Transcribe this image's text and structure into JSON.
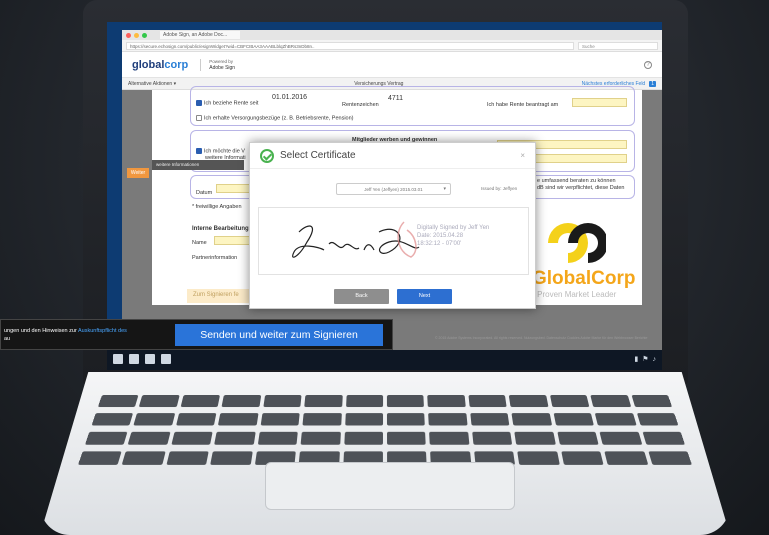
{
  "browser": {
    "tab_title": "Adobe Sign, an Adobe Doc...",
    "url": "https://secure.echosign.com/public/esignWidget?wid=CBFCIBAA3AAABLblqZhBRs3nDb8n..",
    "search_placeholder": "Suche"
  },
  "app": {
    "logo_main": "global",
    "logo_accent": "corp",
    "app_label_small": "Powered by",
    "app_label": "Adobe Sign"
  },
  "docbar": {
    "left_menu": "Alternative Aktionen ▾",
    "title": "Versicherungs Vertrag",
    "right_link": "Nächstes erforderliches Feld",
    "count": "1"
  },
  "form": {
    "rente_label": "Ich beziehe Rente seit",
    "rente_date": "01.01.2016",
    "rentenzeichen_label": "Rentenzeichen",
    "rentenzeichen_value": "4711",
    "beantragt_label": "Ich habe Rente beantragt am",
    "versorgung_label": "Ich erhalte Versorgungsbezüge (z. B. Betriebsrente, Pension)",
    "mitglieder_heading": "Mitglieder werben und gewinnen",
    "mitglieder_line1": "Ich möchte die V",
    "mitglieder_line2": "weitere Informati",
    "right_text1": "e umfassend beraten zu können",
    "right_text2": "dB sind wir verpflichtet, diese Daten",
    "datum_label": "Datum",
    "freiwillig_label": "* freiwillige Angaben",
    "intern_heading": "Interne Bearbeitung",
    "name_label": "Name",
    "partner_label": "Partnerinformation",
    "sign_button_bg": "Zum Signieren fe",
    "weiter_tag": "Weiter",
    "tooltip": "weitere Informationen"
  },
  "modal": {
    "title": "Select Certificate",
    "certificate": "Jeff Yen (Jeffyen) 2015.03.01",
    "issued_by": "Issued by: Jeffyen",
    "sig_line1": "Digitally Signed by Jeff Yen",
    "sig_line2": "Date: 2015.04.28",
    "sig_line3": "18:32:12 - 07'00'",
    "back_label": "Back",
    "next_label": "Next"
  },
  "brand": {
    "name": "GlobalCorp",
    "tagline": "A Proven Market Leader"
  },
  "footer": "© 2015 Adobe Systems Incorporated. All rights reserved.   Nutzungsbed.   Datenschutz   Cookies   Adobe Marke für den Webbrowser   Berichte",
  "banner": {
    "text_prefix": "ungen und den Hinweisen zur ",
    "text_link": "Auskunftspflicht des",
    "text_suffix": "au",
    "button_label": "Senden und weiter zum Signieren"
  },
  "colors": {
    "accent": "#2d6fd1",
    "brand_orange": "#f4a61a",
    "field_yellow": "#fdf5c2"
  }
}
